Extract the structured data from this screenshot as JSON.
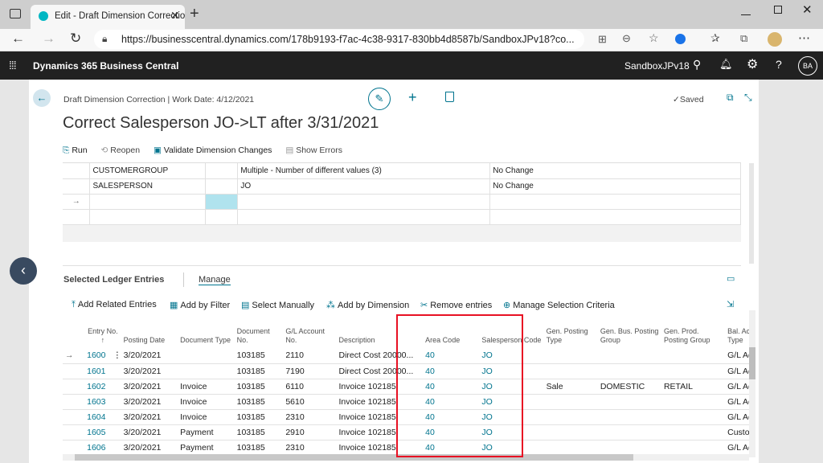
{
  "browser": {
    "tab_title": "Edit - Draft Dimension Correctio",
    "url": "https://businesscentral.dynamics.com/178b9193-f7ac-4c38-9317-830bb4d8587b/SandboxJPv18?co..."
  },
  "app": {
    "title": "Dynamics 365 Business Central",
    "environment": "SandboxJPv18",
    "user_initials": "BA"
  },
  "header": {
    "breadcrumb": "Draft Dimension Correction | Work Date: 4/12/2021",
    "saved": "Saved",
    "page_title": "Correct Salesperson JO->LT after 3/31/2021"
  },
  "actions": {
    "run": "Run",
    "reopen": "Reopen",
    "validate": "Validate Dimension Changes",
    "show_errors": "Show Errors"
  },
  "dimension_rows": [
    {
      "code": "CUSTOMERGROUP",
      "value": "Multiple - Number of different values (3)",
      "change": "No Change"
    },
    {
      "code": "SALESPERSON",
      "value": "JO",
      "change": "No Change"
    }
  ],
  "ledger": {
    "title": "Selected Ledger Entries",
    "manage": "Manage",
    "actions": {
      "add_related": "Add Related Entries",
      "add_filter": "Add by Filter",
      "select_manually": "Select Manually",
      "add_dimension": "Add by Dimension",
      "remove": "Remove entries",
      "manage_criteria": "Manage Selection Criteria"
    },
    "headers": {
      "entry_no": "Entry No. ↑",
      "posting_date": "Posting Date",
      "doc_type": "Document Type",
      "doc_no": "Document No.",
      "gl_acct": "G/L Account No.",
      "description": "Description",
      "area_code": "Area Code",
      "salesperson": "Salesperson Code",
      "gen_posting": "Gen. Posting Type",
      "gen_bus": "Gen. Bus. Posting Group",
      "gen_prod": "Gen. Prod. Posting Group",
      "bal_acct": "Bal. Account Type"
    },
    "rows": [
      {
        "entry": "1600",
        "date": "3/20/2021",
        "type": "",
        "doc": "103185",
        "gl": "2110",
        "desc": "Direct Cost 20000...",
        "area": "40",
        "sp": "JO",
        "gpt": "",
        "gbus": "",
        "gprod": "",
        "bal": "G/L Account"
      },
      {
        "entry": "1601",
        "date": "3/20/2021",
        "type": "",
        "doc": "103185",
        "gl": "7190",
        "desc": "Direct Cost 20000...",
        "area": "40",
        "sp": "JO",
        "gpt": "",
        "gbus": "",
        "gprod": "",
        "bal": "G/L Account"
      },
      {
        "entry": "1602",
        "date": "3/20/2021",
        "type": "Invoice",
        "doc": "103185",
        "gl": "6110",
        "desc": "Invoice 102185",
        "area": "40",
        "sp": "JO",
        "gpt": "Sale",
        "gbus": "DOMESTIC",
        "gprod": "RETAIL",
        "bal": "G/L Account"
      },
      {
        "entry": "1603",
        "date": "3/20/2021",
        "type": "Invoice",
        "doc": "103185",
        "gl": "5610",
        "desc": "Invoice 102185",
        "area": "40",
        "sp": "JO",
        "gpt": "",
        "gbus": "",
        "gprod": "",
        "bal": "G/L Account"
      },
      {
        "entry": "1604",
        "date": "3/20/2021",
        "type": "Invoice",
        "doc": "103185",
        "gl": "2310",
        "desc": "Invoice 102185",
        "area": "40",
        "sp": "JO",
        "gpt": "",
        "gbus": "",
        "gprod": "",
        "bal": "G/L Account"
      },
      {
        "entry": "1605",
        "date": "3/20/2021",
        "type": "Payment",
        "doc": "103185",
        "gl": "2910",
        "desc": "Invoice 102185",
        "area": "40",
        "sp": "JO",
        "gpt": "",
        "gbus": "",
        "gprod": "",
        "bal": "Customer"
      },
      {
        "entry": "1606",
        "date": "3/20/2021",
        "type": "Payment",
        "doc": "103185",
        "gl": "2310",
        "desc": "Invoice 102185",
        "area": "40",
        "sp": "JO",
        "gpt": "",
        "gbus": "",
        "gprod": "",
        "bal": "G/L Account"
      }
    ]
  },
  "colors": {
    "accent": "#00748e",
    "highlight_box": "#e81123",
    "nav_bg": "#212121"
  }
}
